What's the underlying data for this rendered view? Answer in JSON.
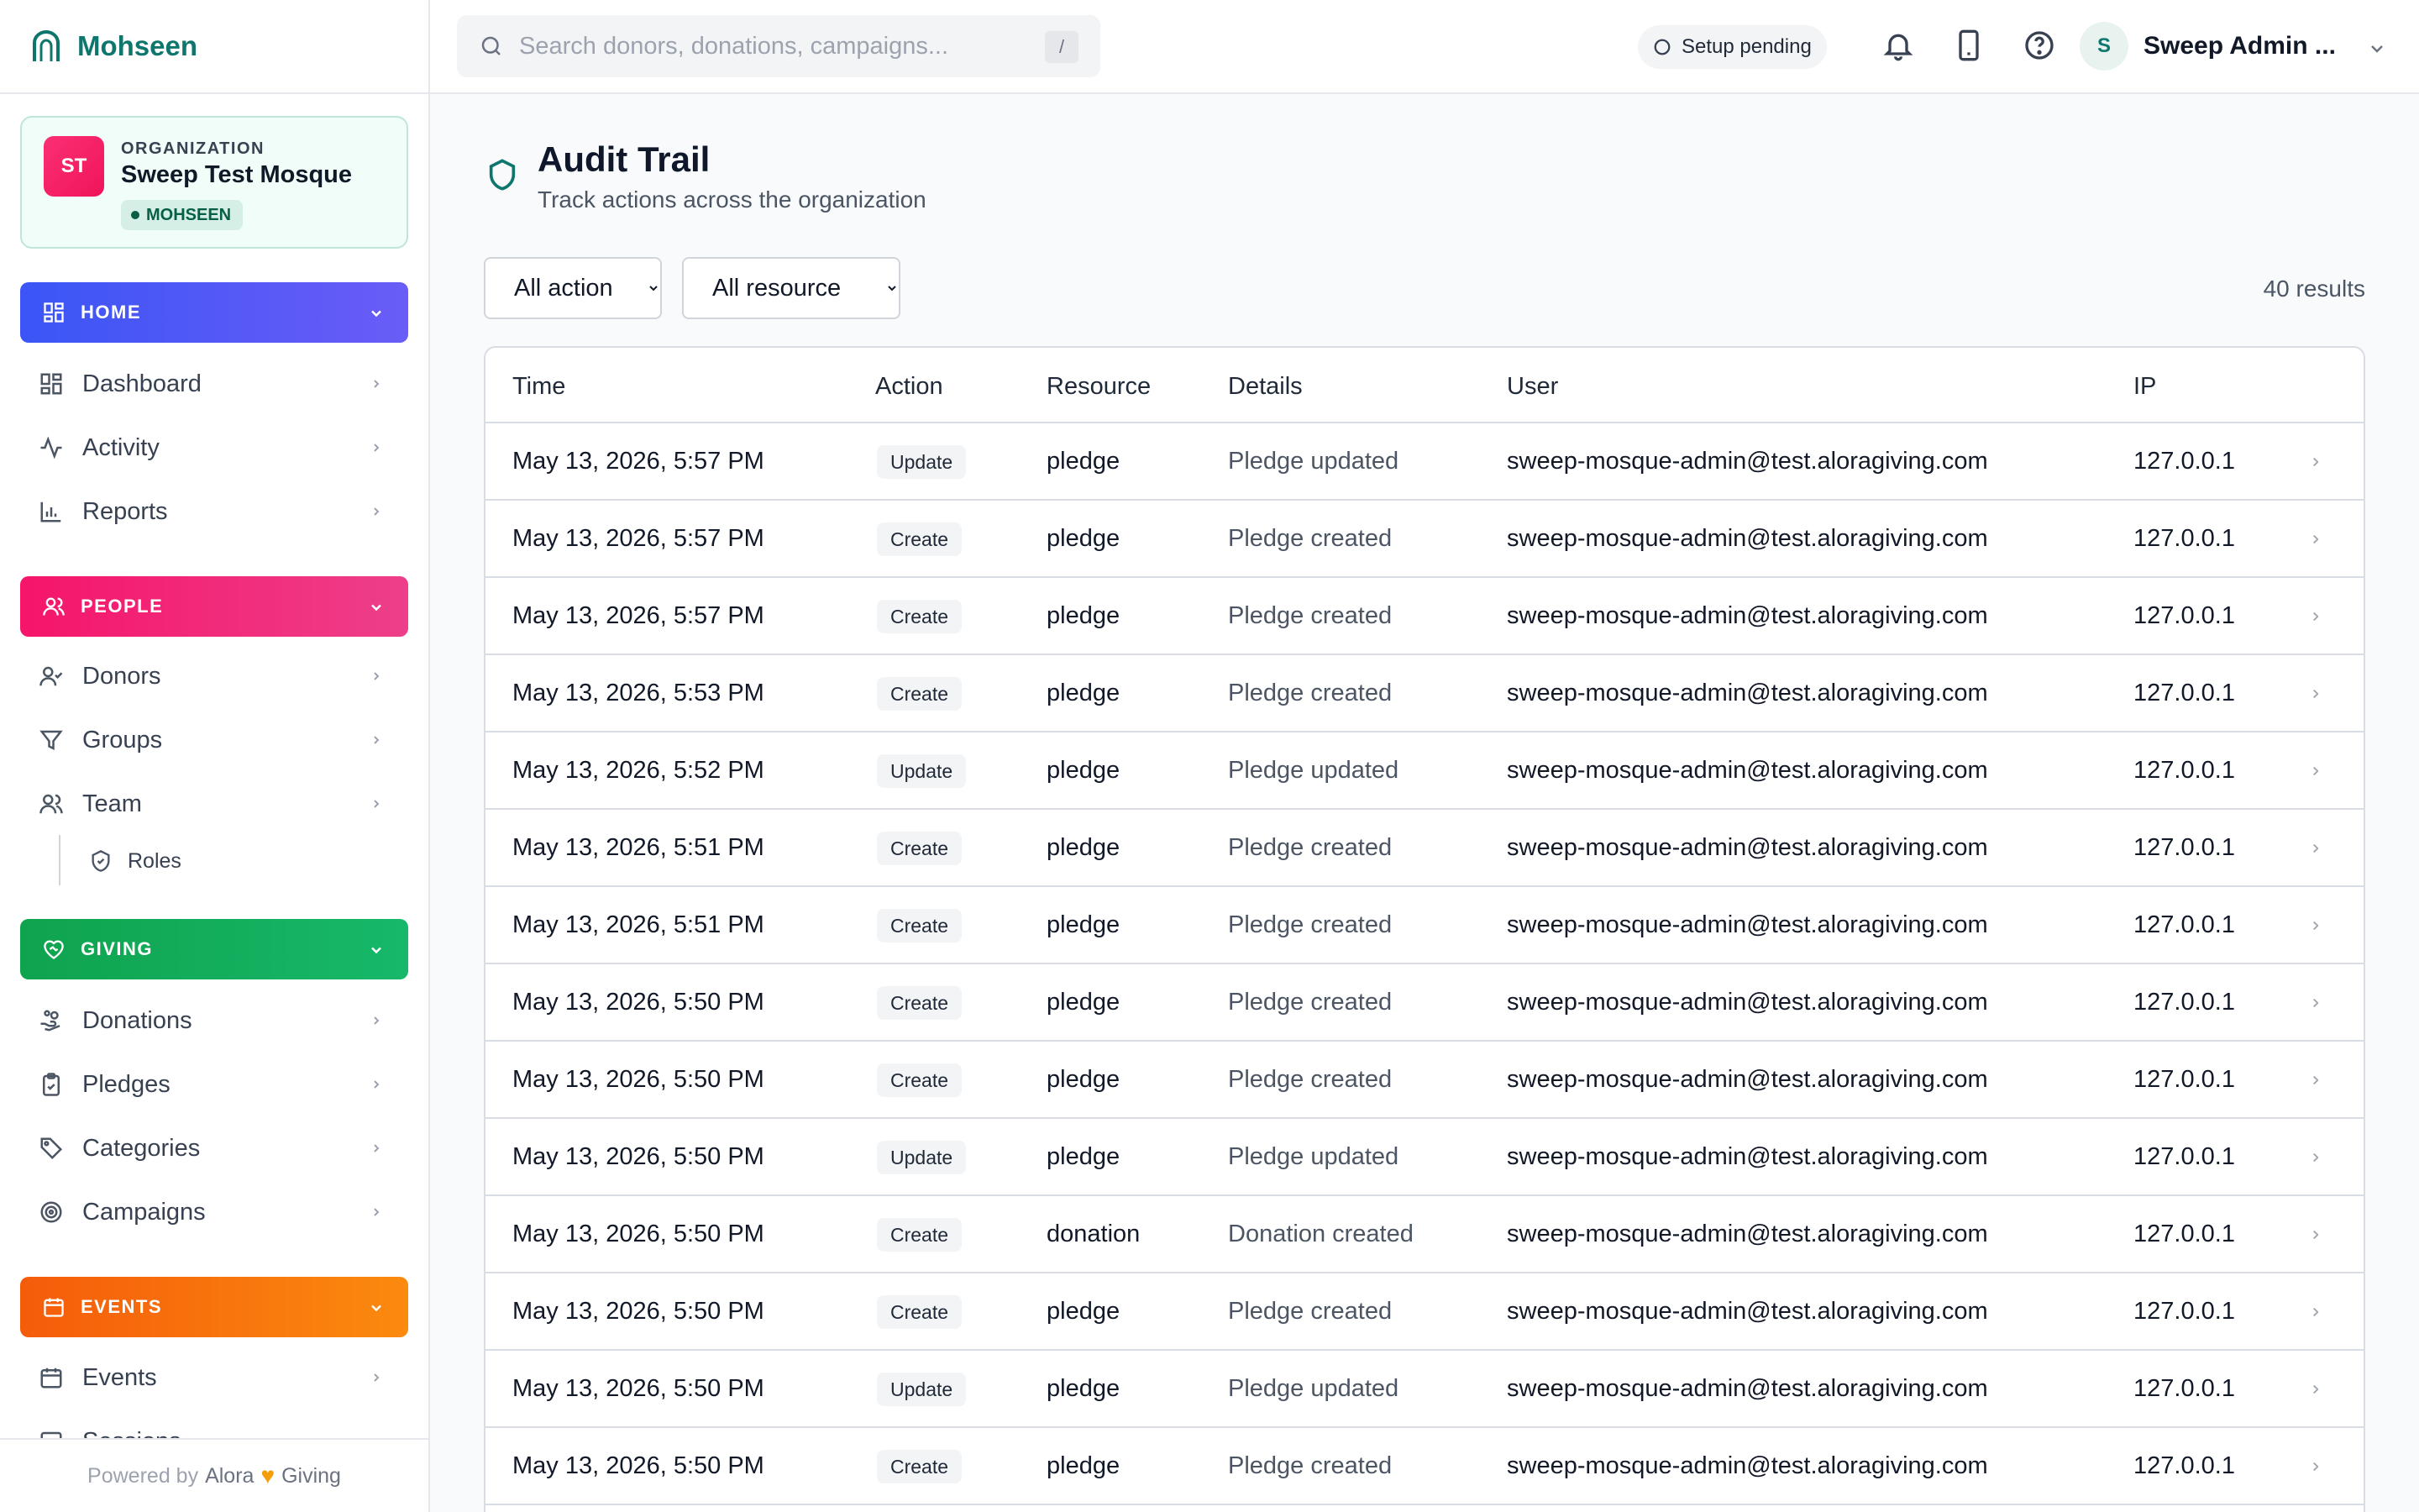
{
  "brand": {
    "name": "Mohseen"
  },
  "organization": {
    "label": "ORGANIZATION",
    "name": "Sweep Test Mosque",
    "initials": "ST",
    "badge": "MOHSEEN"
  },
  "sidebar": {
    "sections": {
      "home": "HOME",
      "people": "PEOPLE",
      "giving": "GIVING",
      "events": "EVENTS"
    },
    "items": {
      "dashboard": "Dashboard",
      "activity": "Activity",
      "reports": "Reports",
      "donors": "Donors",
      "groups": "Groups",
      "team": "Team",
      "roles": "Roles",
      "donations": "Donations",
      "pledges": "Pledges",
      "categories": "Categories",
      "campaigns": "Campaigns",
      "events": "Events",
      "sessions": "Sessions"
    },
    "footer": {
      "powered": "Powered by",
      "alora": "Alora",
      "giving": "Giving"
    }
  },
  "topbar": {
    "search_placeholder": "Search donors, donations, campaigns...",
    "search_shortcut": "/",
    "setup_status": "Setup pending",
    "user_initial": "S",
    "user_name": "Sweep Admin ..."
  },
  "page": {
    "title": "Audit Trail",
    "subtitle": "Track actions across the organization",
    "filter_action": "All action",
    "filter_resource": "All resource",
    "results": "40 results"
  },
  "table": {
    "headers": {
      "time": "Time",
      "action": "Action",
      "resource": "Resource",
      "details": "Details",
      "user": "User",
      "ip": "IP"
    },
    "rows": [
      {
        "time": "May 13, 2026, 5:57 PM",
        "action": "Update",
        "resource": "pledge",
        "details": "Pledge updated",
        "user": "sweep-mosque-admin@test.aloragiving.com",
        "ip": "127.0.0.1"
      },
      {
        "time": "May 13, 2026, 5:57 PM",
        "action": "Create",
        "resource": "pledge",
        "details": "Pledge created",
        "user": "sweep-mosque-admin@test.aloragiving.com",
        "ip": "127.0.0.1"
      },
      {
        "time": "May 13, 2026, 5:57 PM",
        "action": "Create",
        "resource": "pledge",
        "details": "Pledge created",
        "user": "sweep-mosque-admin@test.aloragiving.com",
        "ip": "127.0.0.1"
      },
      {
        "time": "May 13, 2026, 5:53 PM",
        "action": "Create",
        "resource": "pledge",
        "details": "Pledge created",
        "user": "sweep-mosque-admin@test.aloragiving.com",
        "ip": "127.0.0.1"
      },
      {
        "time": "May 13, 2026, 5:52 PM",
        "action": "Update",
        "resource": "pledge",
        "details": "Pledge updated",
        "user": "sweep-mosque-admin@test.aloragiving.com",
        "ip": "127.0.0.1"
      },
      {
        "time": "May 13, 2026, 5:51 PM",
        "action": "Create",
        "resource": "pledge",
        "details": "Pledge created",
        "user": "sweep-mosque-admin@test.aloragiving.com",
        "ip": "127.0.0.1"
      },
      {
        "time": "May 13, 2026, 5:51 PM",
        "action": "Create",
        "resource": "pledge",
        "details": "Pledge created",
        "user": "sweep-mosque-admin@test.aloragiving.com",
        "ip": "127.0.0.1"
      },
      {
        "time": "May 13, 2026, 5:50 PM",
        "action": "Create",
        "resource": "pledge",
        "details": "Pledge created",
        "user": "sweep-mosque-admin@test.aloragiving.com",
        "ip": "127.0.0.1"
      },
      {
        "time": "May 13, 2026, 5:50 PM",
        "action": "Create",
        "resource": "pledge",
        "details": "Pledge created",
        "user": "sweep-mosque-admin@test.aloragiving.com",
        "ip": "127.0.0.1"
      },
      {
        "time": "May 13, 2026, 5:50 PM",
        "action": "Update",
        "resource": "pledge",
        "details": "Pledge updated",
        "user": "sweep-mosque-admin@test.aloragiving.com",
        "ip": "127.0.0.1"
      },
      {
        "time": "May 13, 2026, 5:50 PM",
        "action": "Create",
        "resource": "donation",
        "details": "Donation created",
        "user": "sweep-mosque-admin@test.aloragiving.com",
        "ip": "127.0.0.1"
      },
      {
        "time": "May 13, 2026, 5:50 PM",
        "action": "Create",
        "resource": "pledge",
        "details": "Pledge created",
        "user": "sweep-mosque-admin@test.aloragiving.com",
        "ip": "127.0.0.1"
      },
      {
        "time": "May 13, 2026, 5:50 PM",
        "action": "Update",
        "resource": "pledge",
        "details": "Pledge updated",
        "user": "sweep-mosque-admin@test.aloragiving.com",
        "ip": "127.0.0.1"
      },
      {
        "time": "May 13, 2026, 5:50 PM",
        "action": "Create",
        "resource": "pledge",
        "details": "Pledge created",
        "user": "sweep-mosque-admin@test.aloragiving.com",
        "ip": "127.0.0.1"
      }
    ]
  }
}
